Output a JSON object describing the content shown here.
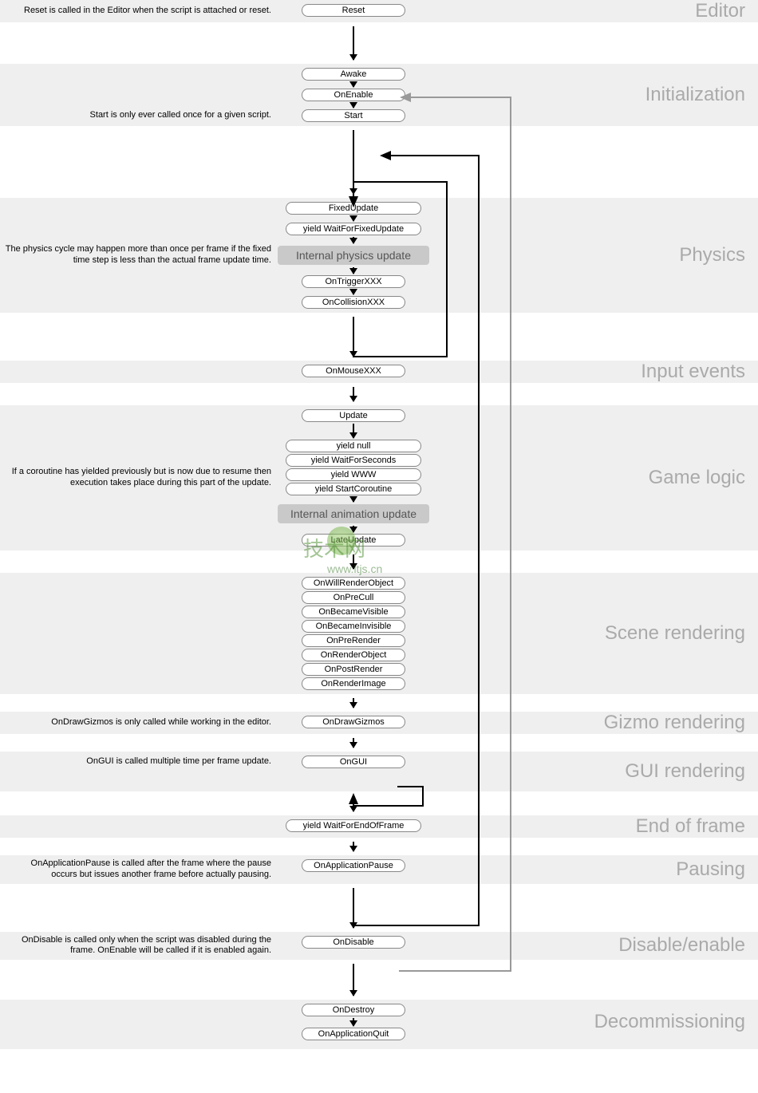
{
  "sections": {
    "editor": {
      "title": "Editor",
      "note": "Reset is called in the Editor when the script is attached or reset.",
      "nodes": [
        "Reset"
      ]
    },
    "initialization": {
      "title": "Initialization",
      "note": "Start is only ever called once for a given script.",
      "nodes": [
        "Awake",
        "OnEnable",
        "Start"
      ]
    },
    "physics": {
      "title": "Physics",
      "note": "The physics cycle may happen more than once per frame if the fixed time step is less than the actual frame update time.",
      "nodes": [
        "FixedUpdate",
        "yield WaitForFixedUpdate"
      ],
      "internal": "Internal physics update",
      "nodes2": [
        "OnTriggerXXX",
        "OnCollisionXXX"
      ]
    },
    "input": {
      "title": "Input events",
      "nodes": [
        "OnMouseXXX"
      ]
    },
    "gamelogic": {
      "title": "Game logic",
      "note": "If a coroutine has yielded previously but is now due to resume then execution takes place during this part of the update.",
      "nodes": [
        "Update"
      ],
      "yields": [
        "yield null",
        "yield WaitForSeconds",
        "yield WWW",
        "yield StartCoroutine"
      ],
      "internal": "Internal animation update",
      "nodes2": [
        "LateUpdate"
      ]
    },
    "scene": {
      "title": "Scene rendering",
      "nodes": [
        "OnWillRenderObject",
        "OnPreCull",
        "OnBecameVisible",
        "OnBecameInvisible",
        "OnPreRender",
        "OnRenderObject",
        "OnPostRender",
        "OnRenderImage"
      ]
    },
    "gizmo": {
      "title": "Gizmo rendering",
      "note": "OnDrawGizmos is only called while working in the editor.",
      "nodes": [
        "OnDrawGizmos"
      ]
    },
    "gui": {
      "title": "GUI rendering",
      "note": "OnGUI is called multiple time per frame update.",
      "nodes": [
        "OnGUI"
      ]
    },
    "endframe": {
      "title": "End of frame",
      "nodes": [
        "yield WaitForEndOfFrame"
      ]
    },
    "pausing": {
      "title": "Pausing",
      "note": "OnApplicationPause is called after the frame where the pause occurs but issues another frame before actually pausing.",
      "nodes": [
        "OnApplicationPause"
      ]
    },
    "disable": {
      "title": "Disable/enable",
      "note": "OnDisable is called only when the script was disabled during the frame. OnEnable will be called if it is enabled again.",
      "nodes": [
        "OnDisable"
      ]
    },
    "decommission": {
      "title": "Decommissioning",
      "nodes": [
        "OnDestroy",
        "OnApplicationQuit"
      ]
    }
  },
  "watermark": {
    "text": "技术网",
    "url": "www.itjs.cn"
  }
}
